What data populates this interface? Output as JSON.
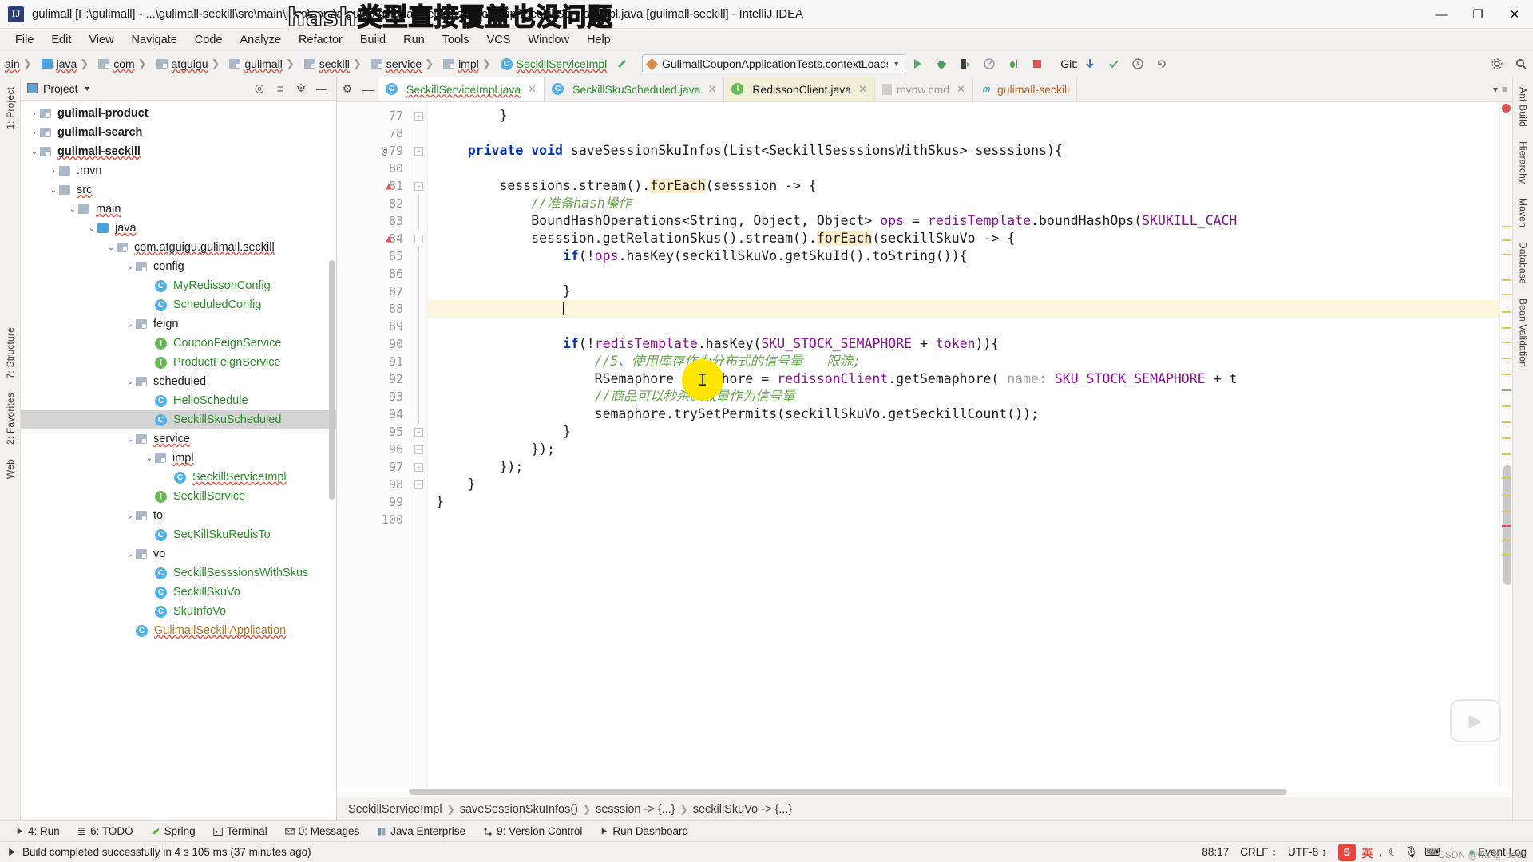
{
  "window": {
    "title": "gulimall [F:\\gulimall] - ...\\gulimall-seckill\\src\\main\\java\\com\\atguigu\\gulimall\\seckill\\service\\impl\\SeckillServiceImpl.java [gulimall-seckill] - IntelliJ IDEA",
    "logo": "IJ",
    "minimize": "—",
    "maximize": "❐",
    "close": "✕",
    "watermark": "hash类型直接覆盖也没问题"
  },
  "menu": [
    "File",
    "Edit",
    "View",
    "Navigate",
    "Code",
    "Analyze",
    "Refactor",
    "Build",
    "Run",
    "Tools",
    "VCS",
    "Window",
    "Help"
  ],
  "navbar": {
    "crumbs": [
      {
        "label": "ain",
        "icon": "none"
      },
      {
        "label": "java",
        "icon": "folder-blue"
      },
      {
        "label": "com",
        "icon": "folder-src"
      },
      {
        "label": "atguigu",
        "icon": "folder-src"
      },
      {
        "label": "gulimall",
        "icon": "folder-src"
      },
      {
        "label": "seckill",
        "icon": "folder-src"
      },
      {
        "label": "service",
        "icon": "folder-src"
      },
      {
        "label": "impl",
        "icon": "folder-src"
      },
      {
        "label": "SeckillServiceImpl",
        "icon": "class"
      }
    ],
    "run_config": "GulimallCouponApplicationTests.contextLoads",
    "run_icons": [
      "run-icon",
      "debug-icon",
      "run-coverage-icon",
      "profile-icon",
      "attach-icon",
      "stop-icon"
    ],
    "git_label": "Git:",
    "git_icons": [
      "update-project-icon",
      "commit-icon",
      "history-icon",
      "rollback-icon"
    ],
    "right_icons": [
      "settings-icon",
      "search-everywhere-icon"
    ]
  },
  "left_rail": [
    "1: Project",
    "7: Structure",
    "2: Favorites",
    "Web"
  ],
  "right_rail": [
    "Ant Build",
    "Hierarchy",
    "Maven",
    "Database",
    "Bean Validation"
  ],
  "project_panel": {
    "title": "Project",
    "header_icons": [
      "locate-icon",
      "collapse-all-icon",
      "settings-icon",
      "hide-icon"
    ],
    "tree": [
      {
        "label": "gulimall-product",
        "indent": 1,
        "arrow": "›",
        "icon": "module-folder",
        "bold": true
      },
      {
        "label": "gulimall-search",
        "indent": 1,
        "arrow": "›",
        "icon": "module-folder",
        "bold": true
      },
      {
        "label": "gulimall-seckill",
        "indent": 1,
        "arrow": "⌄",
        "icon": "module-folder",
        "bold": true,
        "spell": true
      },
      {
        "label": ".mvn",
        "indent": 2,
        "arrow": "›",
        "icon": "folder"
      },
      {
        "label": "src",
        "indent": 2,
        "arrow": "⌄",
        "icon": "folder",
        "spell": true
      },
      {
        "label": "main",
        "indent": 3,
        "arrow": "⌄",
        "icon": "folder",
        "spell": true
      },
      {
        "label": "java",
        "indent": 4,
        "arrow": "⌄",
        "icon": "folder-blue",
        "spell": true
      },
      {
        "label": "com.atguigu.gulimall.seckill",
        "indent": 5,
        "arrow": "⌄",
        "icon": "package",
        "spell": true
      },
      {
        "label": "config",
        "indent": 6,
        "arrow": "⌄",
        "icon": "package"
      },
      {
        "label": "MyRedissonConfig",
        "indent": 7,
        "arrow": "",
        "icon": "class",
        "green": true
      },
      {
        "label": "ScheduledConfig",
        "indent": 7,
        "arrow": "",
        "icon": "class",
        "green": true
      },
      {
        "label": "feign",
        "indent": 6,
        "arrow": "⌄",
        "icon": "package"
      },
      {
        "label": "CouponFeignService",
        "indent": 7,
        "arrow": "",
        "icon": "interface",
        "green": true
      },
      {
        "label": "ProductFeignService",
        "indent": 7,
        "arrow": "",
        "icon": "interface",
        "green": true
      },
      {
        "label": "scheduled",
        "indent": 6,
        "arrow": "⌄",
        "icon": "package"
      },
      {
        "label": "HelloSchedule",
        "indent": 7,
        "arrow": "",
        "icon": "class",
        "green": true
      },
      {
        "label": "SeckillSkuScheduled",
        "indent": 7,
        "arrow": "",
        "icon": "class",
        "green": true,
        "selected": true
      },
      {
        "label": "service",
        "indent": 6,
        "arrow": "⌄",
        "icon": "package",
        "spell": true
      },
      {
        "label": "impl",
        "indent": 7,
        "arrow": "⌄",
        "icon": "package",
        "spell": true
      },
      {
        "label": "SeckillServiceImpl",
        "indent": 8,
        "arrow": "",
        "icon": "class",
        "green": true,
        "spell": true
      },
      {
        "label": "SeckillService",
        "indent": 7,
        "arrow": "",
        "icon": "interface",
        "green": true
      },
      {
        "label": "to",
        "indent": 6,
        "arrow": "⌄",
        "icon": "package"
      },
      {
        "label": "SecKillSkuRedisTo",
        "indent": 7,
        "arrow": "",
        "icon": "class",
        "green": true
      },
      {
        "label": "vo",
        "indent": 6,
        "arrow": "⌄",
        "icon": "package"
      },
      {
        "label": "SeckillSesssionsWithSkus",
        "indent": 7,
        "arrow": "",
        "icon": "class",
        "green": true
      },
      {
        "label": "SeckillSkuVo",
        "indent": 7,
        "arrow": "",
        "icon": "class",
        "green": true
      },
      {
        "label": "SkuInfoVo",
        "indent": 7,
        "arrow": "",
        "icon": "class",
        "green": true
      },
      {
        "label": "GulimallSeckillApplication",
        "indent": 6,
        "arrow": "",
        "icon": "runnable-class",
        "runnable": true,
        "spell": true
      }
    ]
  },
  "editor_tabs": [
    {
      "label": "SeckillServiceImpl.java",
      "icon": "class",
      "state": "active",
      "spell": true
    },
    {
      "label": "SeckillSkuScheduled.java",
      "icon": "class",
      "state": "normal"
    },
    {
      "label": "RedissonClient.java",
      "icon": "interface",
      "state": "yellow"
    },
    {
      "label": "mvnw.cmd",
      "icon": "file",
      "state": "dim"
    },
    {
      "label": "gulimall-seckill",
      "icon": "maven",
      "state": "maven"
    }
  ],
  "editor": {
    "first_line": 77,
    "lines": [
      {
        "n": 77,
        "text": "        }"
      },
      {
        "n": 78,
        "text": ""
      },
      {
        "n": 79,
        "text": "    private void saveSessionSkuInfos(List<SeckillSesssionsWithSkus> sesssions){",
        "gutter_icon": "@"
      },
      {
        "n": 80,
        "text": ""
      },
      {
        "n": 81,
        "text": "        sesssions.stream().forEach(sesssion -> {",
        "gutter_icon": "warning"
      },
      {
        "n": 82,
        "text": "            //准备hash操作"
      },
      {
        "n": 83,
        "text": "            BoundHashOperations<String, Object, Object> ops = redisTemplate.boundHashOps(SKUKILL_CACH"
      },
      {
        "n": 84,
        "text": "            sesssion.getRelationSkus().stream().forEach(seckillSkuVo -> {",
        "gutter_icon": "warning"
      },
      {
        "n": 85,
        "text": "                if(!ops.hasKey(seckillSkuVo.getSkuId().toString()){"
      },
      {
        "n": 86,
        "text": ""
      },
      {
        "n": 87,
        "text": "                }",
        "gutter_icon": "lamp"
      },
      {
        "n": 88,
        "text": "",
        "highlight": true,
        "caret": true
      },
      {
        "n": 89,
        "text": ""
      },
      {
        "n": 90,
        "text": "                if(!redisTemplate.hasKey(SKU_STOCK_SEMAPHORE + token)){"
      },
      {
        "n": 91,
        "text": "                    //5、使用库存作为分布式的信号量   限流;"
      },
      {
        "n": 92,
        "text": "                    RSemaphore semaphore = redissonClient.getSemaphore( name: SKU_STOCK_SEMAPHORE + t"
      },
      {
        "n": 93,
        "text": "                    //商品可以秒杀的数量作为信号量"
      },
      {
        "n": 94,
        "text": "                    semaphore.trySetPermits(seckillSkuVo.getSeckillCount());"
      },
      {
        "n": 95,
        "text": "                }"
      },
      {
        "n": 96,
        "text": "            });"
      },
      {
        "n": 97,
        "text": "        });"
      },
      {
        "n": 98,
        "text": "    }"
      },
      {
        "n": 99,
        "text": "}"
      },
      {
        "n": 100,
        "text": ""
      }
    ]
  },
  "breadcrumbs": [
    "SeckillServiceImpl",
    "saveSessionSkuInfos()",
    "sesssion -> {...}",
    "seckillSkuVo -> {...}"
  ],
  "bottom_tool_windows": [
    {
      "num": "4",
      "label": "Run",
      "icon": "run-icon"
    },
    {
      "num": "6",
      "label": "TODO",
      "icon": "todo-icon"
    },
    {
      "num": "",
      "label": "Spring",
      "icon": "spring-icon"
    },
    {
      "num": "",
      "label": "Terminal",
      "icon": "terminal-icon"
    },
    {
      "num": "0",
      "label": "Messages",
      "icon": "messages-icon"
    },
    {
      "num": "",
      "label": "Java Enterprise",
      "icon": "javaee-icon"
    },
    {
      "num": "9",
      "label": "Version Control",
      "icon": "vcs-icon"
    },
    {
      "num": "",
      "label": "Run Dashboard",
      "icon": "dashboard-icon"
    }
  ],
  "statusbar": {
    "message": "Build completed successfully in 4 s 105 ms (37 minutes ago)",
    "position": "88:17",
    "line_separator": "CRLF",
    "encoding": "UTF-8",
    "ime_badge": "S",
    "ime_lang": "英",
    "event_log": "Event Log",
    "csdn": "CSDN @wang_book"
  },
  "colors": {
    "keyword": "#0033b3",
    "field": "#871094",
    "comment": "#8c8c8c",
    "chinese_comment": "#6aa84f",
    "highlight": "#fbeec8",
    "caret_line": "#fdf6dd",
    "error": "#d9534f",
    "accent_green": "#59a869",
    "cursor_blob": "#ffe500"
  }
}
